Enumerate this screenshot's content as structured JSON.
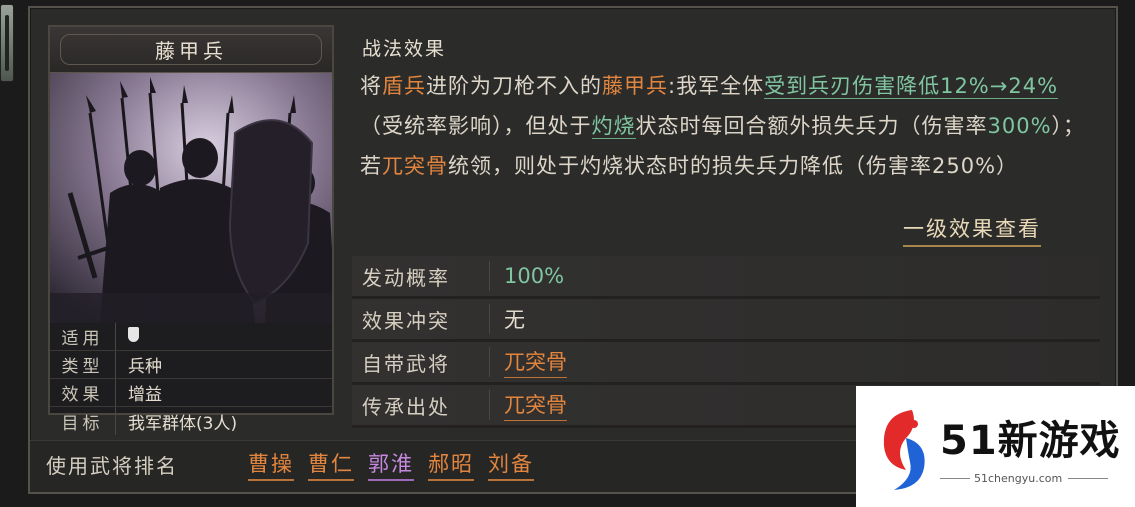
{
  "card": {
    "title": "藤甲兵",
    "attributes": [
      {
        "key": "适用",
        "value": "",
        "icon": "shield-icon"
      },
      {
        "key": "类型",
        "value": "兵种"
      },
      {
        "key": "效果",
        "value": "增益"
      },
      {
        "key": "目标",
        "value": "我军群体(3人)"
      }
    ]
  },
  "effect": {
    "title": "战法效果",
    "seg1": "将",
    "seg2": "盾兵",
    "seg3": "进阶为刀枪不入的",
    "seg4": "藤甲兵",
    "seg5": ":我军全体",
    "seg6": "受到兵刃伤害降低",
    "seg7": "12%→24%",
    "seg8": "（受统率影响），但处于",
    "seg9": "灼烧",
    "seg10": "状态时每回合额外损失兵力（伤害率",
    "seg11": "300%",
    "seg12": "）；若",
    "seg13": "兀突骨",
    "seg14": "统领，则处于",
    "seg15": "灼烧状态时的损失兵力降低（伤害率250%）",
    "view_button": "一级效果查看"
  },
  "info_rows": [
    {
      "key": "发动概率",
      "value": "100%"
    },
    {
      "key": "效果冲突",
      "value": "无"
    },
    {
      "key": "自带武将",
      "value": "兀突骨"
    },
    {
      "key": "传承出处",
      "value": "兀突骨"
    }
  ],
  "ranking": {
    "label": "使用武将排名",
    "names": [
      "曹操",
      "曹仁",
      "郭淮",
      "郝昭",
      "刘备"
    ]
  },
  "watermark": {
    "text": "51新游戏",
    "url": "51chengyu.com"
  },
  "colors": {
    "accent_orange": "#e2853e",
    "accent_green": "#7fc6a0",
    "accent_purple": "#c58ae0"
  }
}
